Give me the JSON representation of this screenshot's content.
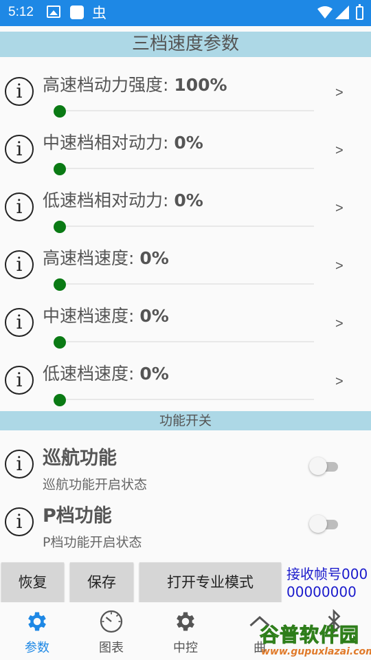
{
  "status_bar": {
    "time": "5:12",
    "bug_glyph": "虫"
  },
  "sections": {
    "speed_title": "三档速度参数",
    "function_title": "功能开关"
  },
  "params": [
    {
      "label": "高速档动力强度: ",
      "value": "100%",
      "slider_fraction": 0.0
    },
    {
      "label": "中速档相对动力: ",
      "value": "0%",
      "slider_fraction": 0.0
    },
    {
      "label": "低速档相对动力: ",
      "value": "0%",
      "slider_fraction": 0.0
    },
    {
      "label": "高速档速度: ",
      "value": "0%",
      "slider_fraction": 0.0
    },
    {
      "label": "中速档速度: ",
      "value": "0%",
      "slider_fraction": 0.0
    },
    {
      "label": "低速档速度: ",
      "value": "0%",
      "slider_fraction": 0.0
    }
  ],
  "info_glyph": "i",
  "chevron_glyph": ">",
  "functions": [
    {
      "title": "巡航功能",
      "subtitle": "巡航功能开启状态",
      "enabled": false
    },
    {
      "title": "P档功能",
      "subtitle": "P档功能开启状态",
      "enabled": false
    }
  ],
  "actions": {
    "restore": "恢复",
    "save": "保存",
    "pro_mode": "打开专业模式"
  },
  "frame_counter": "接收帧号00000000000",
  "nav": [
    {
      "label": "参数",
      "icon": "gear-icon",
      "active": true
    },
    {
      "label": "图表",
      "icon": "gauge-icon",
      "active": false
    },
    {
      "label": "中控",
      "icon": "gear-icon",
      "active": false
    },
    {
      "label": "曲",
      "icon": "chevron-up-icon",
      "active": false
    },
    {
      "label": "",
      "icon": "bluetooth-icon",
      "active": false
    }
  ],
  "watermark": {
    "main": "谷普软件园",
    "url": "www.gupuxlazai.com"
  },
  "colors": {
    "status_bar": "#1e88e5",
    "section_header": "#add8e6",
    "slider_thumb": "#0a7a14",
    "frame_counter": "#1a1acc",
    "nav_active": "#1e88e5"
  }
}
